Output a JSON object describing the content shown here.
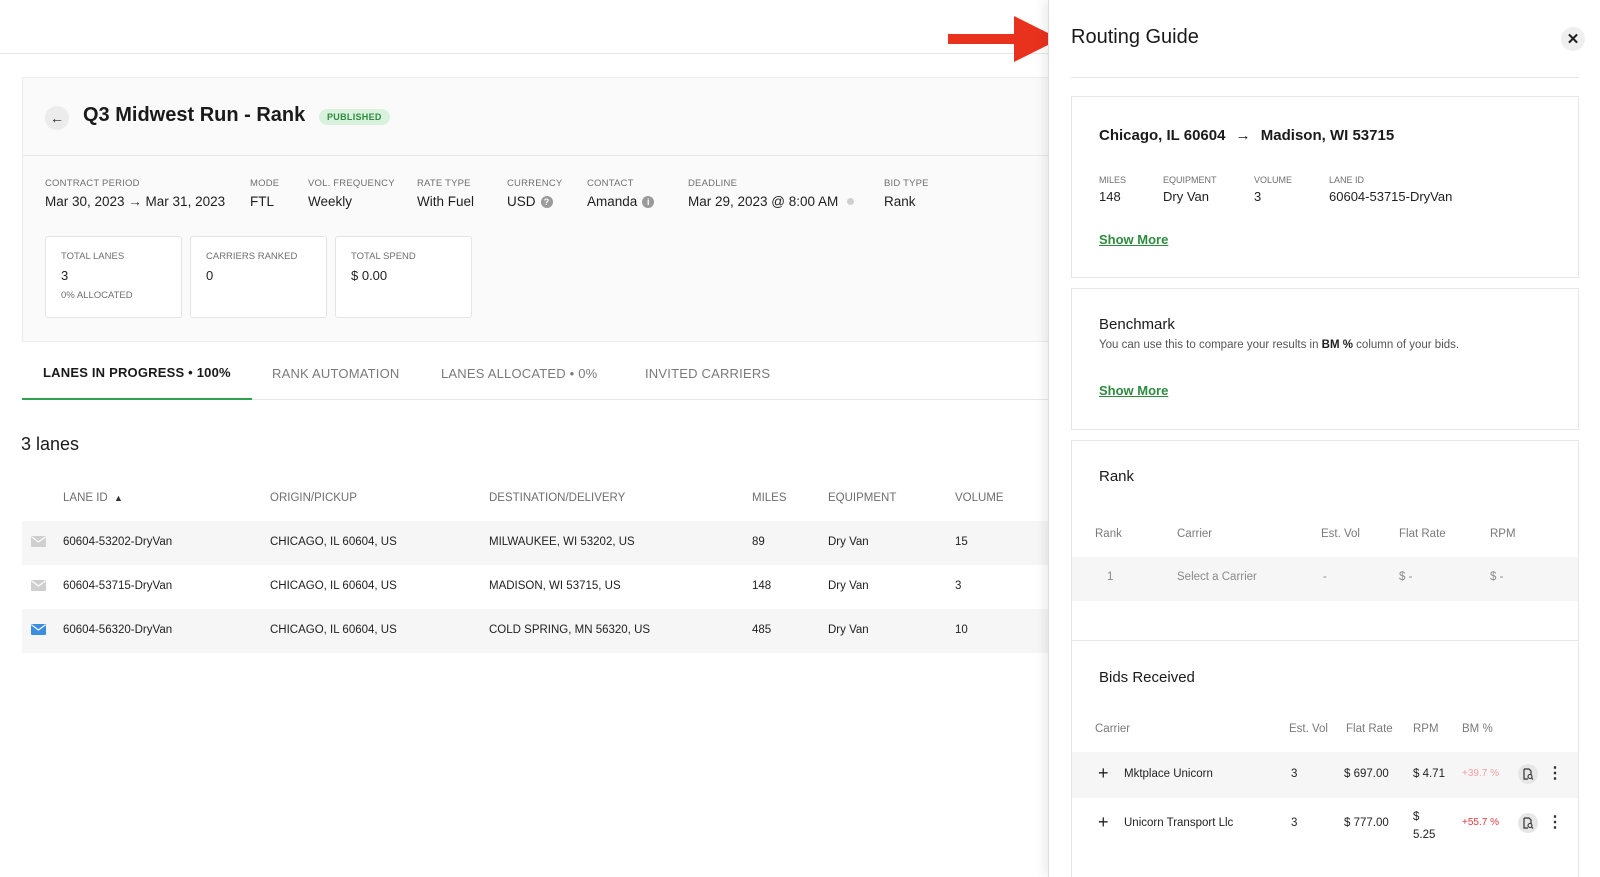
{
  "page": {
    "title": "Q3 Midwest Run - Rank",
    "status_badge": "PUBLISHED"
  },
  "meta": [
    {
      "label": "CONTRACT PERIOD",
      "value": "Mar 30, 2023 → Mar 31, 2023"
    },
    {
      "label": "MODE",
      "value": "FTL"
    },
    {
      "label": "VOL. FREQUENCY",
      "value": "Weekly"
    },
    {
      "label": "RATE TYPE",
      "value": "With Fuel"
    },
    {
      "label": "CURRENCY",
      "value": "USD"
    },
    {
      "label": "CONTACT",
      "value": "Amanda"
    },
    {
      "label": "DEADLINE",
      "value": "Mar 29, 2023 @ 8:00 AM"
    },
    {
      "label": "BID TYPE",
      "value": "Rank"
    }
  ],
  "stats": [
    {
      "label": "TOTAL LANES",
      "value": "3",
      "sub": "0% ALLOCATED"
    },
    {
      "label": "CARRIERS RANKED",
      "value": "0",
      "sub": ""
    },
    {
      "label": "TOTAL SPEND",
      "value": "$ 0.00",
      "sub": ""
    }
  ],
  "tabs": [
    {
      "label": "LANES IN PROGRESS  •  100%",
      "active": true
    },
    {
      "label": "RANK AUTOMATION",
      "active": false
    },
    {
      "label": "LANES ALLOCATED  •  0%",
      "active": false
    },
    {
      "label": "INVITED CARRIERS",
      "active": false
    }
  ],
  "lanes": {
    "count_label": "3 lanes",
    "columns": [
      "LANE ID",
      "ORIGIN/PICKUP",
      "DESTINATION/DELIVERY",
      "MILES",
      "EQUIPMENT",
      "VOLUME"
    ],
    "sort_icon": "sort-ascending-icon",
    "rows": [
      {
        "lane_id": "60604-53202-DryVan",
        "origin": "CHICAGO, IL 60604, US",
        "destination": "MILWAUKEE, WI 53202, US",
        "miles": "89",
        "equipment": "Dry Van",
        "volume": "15",
        "mail_icon": "mail-icon",
        "mail_color": "#cfcfcf"
      },
      {
        "lane_id": "60604-53715-DryVan",
        "origin": "CHICAGO, IL 60604, US",
        "destination": "MADISON, WI 53715, US",
        "miles": "148",
        "equipment": "Dry Van",
        "volume": "3",
        "mail_icon": "mail-icon",
        "mail_color": "#cfcfcf"
      },
      {
        "lane_id": "60604-56320-DryVan",
        "origin": "CHICAGO, IL 60604, US",
        "destination": "COLD SPRING, MN 56320, US",
        "miles": "485",
        "equipment": "Dry Van",
        "volume": "10",
        "mail_icon": "mail-icon",
        "mail_color": "#3b8de0"
      }
    ]
  },
  "drawer": {
    "title": "Routing Guide",
    "close_icon": "close-icon",
    "lane": {
      "origin": "Chicago, IL 60604",
      "destination": "Madison, WI 53715",
      "details": [
        {
          "label": "MILES",
          "value": "148"
        },
        {
          "label": "EQUIPMENT",
          "value": "Dry Van"
        },
        {
          "label": "VOLUME",
          "value": "3"
        },
        {
          "label": "LANE ID",
          "value": "60604-53715-DryVan"
        }
      ],
      "show_more": "Show More"
    },
    "benchmark": {
      "title": "Benchmark",
      "desc_before": "You can use this to compare your results in ",
      "desc_bold": "BM %",
      "desc_after": " column of your bids.",
      "show_more": "Show More"
    },
    "rank": {
      "title": "Rank",
      "columns": [
        "Rank",
        "Carrier",
        "Est. Vol",
        "Flat Rate",
        "RPM"
      ],
      "rows": [
        {
          "rank": "1",
          "carrier": "Select a Carrier",
          "est_vol": "-",
          "flat_rate": "$ -",
          "rpm": "$ -"
        }
      ]
    },
    "bids": {
      "title": "Bids Received",
      "columns": [
        "Carrier",
        "Est. Vol",
        "Flat Rate",
        "RPM",
        "BM %"
      ],
      "rows": [
        {
          "carrier": "Mktplace Unicorn",
          "est_vol": "3",
          "flat_rate": "$ 697.00",
          "rpm": "$ 4.71",
          "bm": "+39.7 %",
          "bm_color": "#f2a0a0"
        },
        {
          "carrier": "Unicorn Transport Llc",
          "est_vol": "3",
          "flat_rate": "$ 777.00",
          "rpm": "$ 5.25",
          "bm": "+55.7 %",
          "bm_color": "#e0393e"
        }
      ]
    }
  },
  "colors": {
    "accent_green": "#2e8b3e",
    "tab_underline": "#2ea44f",
    "annotation_arrow": "#e8321e"
  }
}
